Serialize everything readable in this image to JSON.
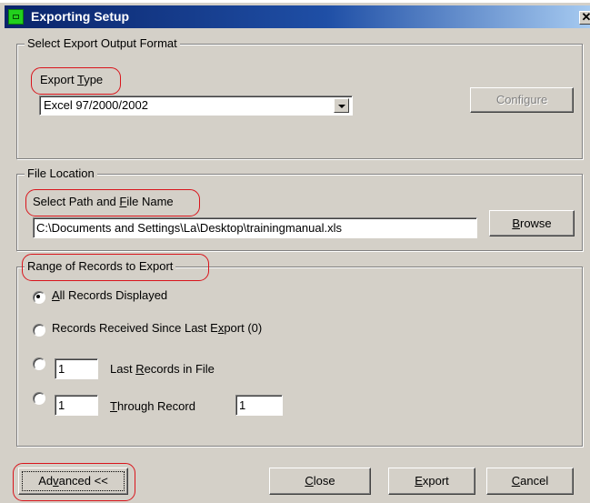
{
  "window": {
    "title": "Exporting Setup",
    "close_glyph": "✕"
  },
  "export_format": {
    "legend": "Select Export Output Format",
    "type_label_pre": "Export ",
    "type_label_key": "T",
    "type_label_post": "ype",
    "selected_type": "Excel 97/2000/2002",
    "configure_label": "Configure"
  },
  "file_location": {
    "legend": "File Location",
    "path_label_pre": "Select Path and ",
    "path_label_key": "F",
    "path_label_post": "ile Name",
    "path_value": "C:\\Documents and Settings\\La\\Desktop\\trainingmanual.xls",
    "browse_pre": "",
    "browse_key": "B",
    "browse_post": "rowse"
  },
  "range": {
    "legend": "Range of Records to Export",
    "opt_all_key": "A",
    "opt_all_post": "ll Records Displayed",
    "opt_since_pre": "Records Received Since Last E",
    "opt_since_key": "x",
    "opt_since_post": "port (0)",
    "last_count": "1",
    "last_label_pre": "Last ",
    "last_label_key": "R",
    "last_label_post": "ecords in File",
    "from_value": "1",
    "through_label_key": "T",
    "through_label_post": "hrough Record",
    "to_value": "1",
    "selected_option": "all"
  },
  "footer": {
    "advanced_pre": "Ad",
    "advanced_key": "v",
    "advanced_post": "anced <<",
    "close_pre": "",
    "close_key": "C",
    "close_post": "lose",
    "export_key": "E",
    "export_post": "xport",
    "cancel_key": "C",
    "cancel_post": "ancel"
  },
  "colors": {
    "title_bar": "#0a246a",
    "face": "#d4d0c8",
    "highlight_oval": "#d9141b"
  }
}
